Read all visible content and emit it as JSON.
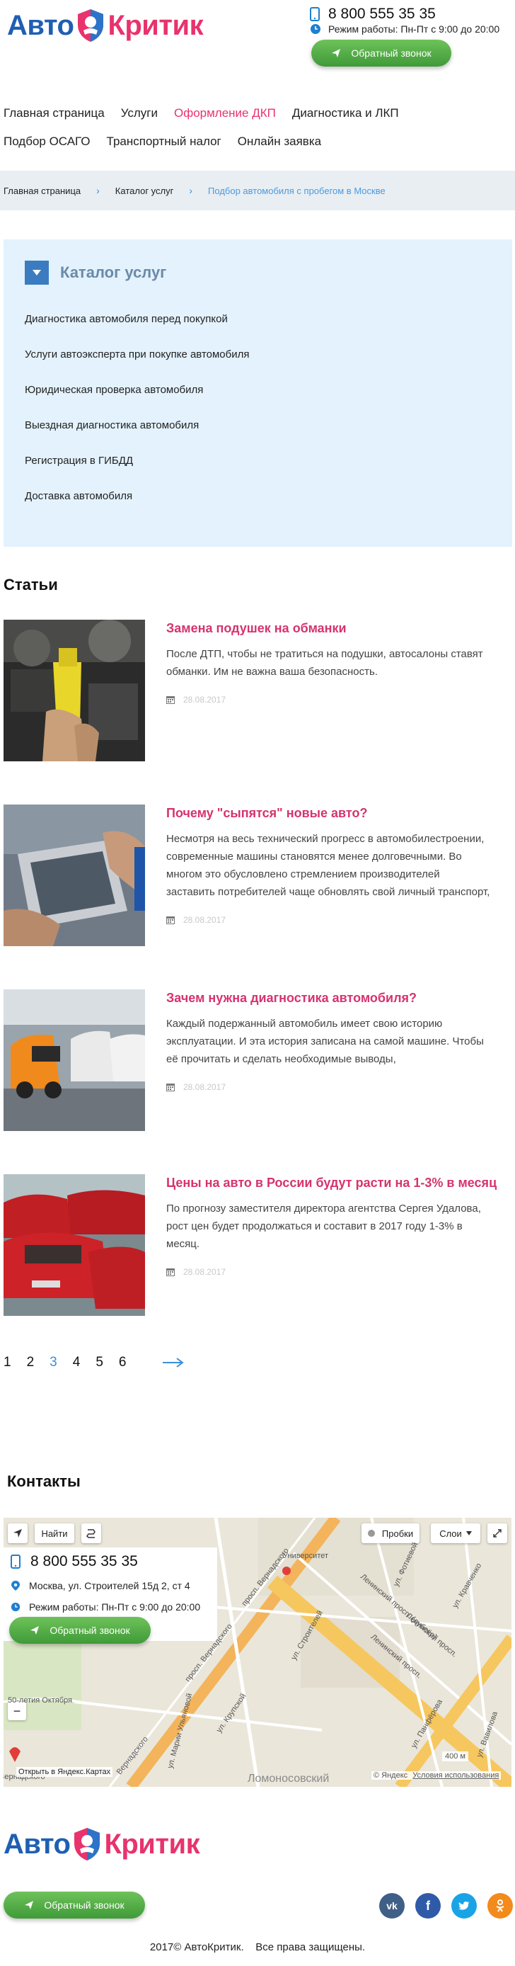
{
  "logo": {
    "part1": "Авто",
    "part2": "Критик"
  },
  "header": {
    "phone": "8 800 555 35 35",
    "hours": "Режим работы: Пн-Пт с 9:00 до 20:00",
    "callback": "Обратный звонок"
  },
  "nav": {
    "row1": [
      "Главная страница",
      "Услуги",
      "Оформление ДКП",
      "Диагностика и ЛКП"
    ],
    "row2": [
      "Подбор ОСАГО",
      "Транспортный налог",
      "Онлайн заявка"
    ],
    "active": "Оформление ДКП"
  },
  "breadcrumb": [
    "Главная страница",
    "Каталог услуг",
    "Подбор автомобиля с пробегом в Москве"
  ],
  "catalog": {
    "title": "Каталог услуг",
    "items": [
      "Диагностика автомобиля перед покупкой",
      "Услуги автоэксперта при покупке автомобиля",
      "Юридическая проверка автомобиля",
      "Выездная диагностика автомобиля",
      "Регистрация в ГИБДД",
      "Доставка автомобиля"
    ]
  },
  "articles_title": "Статьи",
  "articles": [
    {
      "title": "Замена подушек на обманки",
      "text": [
        "После ДТП, чтобы не тратиться на подушки, автосалоны ставят",
        "обманки. Им не важна ваша безопасность."
      ],
      "date": "28.08.2017",
      "image": "airbag-connector-photo"
    },
    {
      "title": "Почему \"сыпятся\" новые авто?",
      "text": [
        "Несмотря на весь технический прогресс в автомобилестроении,",
        "современные машины становятся менее долговечными. Во",
        "многом это обусловлено стремлением производителей",
        "заставить потребителей чаще обновлять свой личный транспорт,"
      ],
      "date": "28.08.2017",
      "image": "diagnostic-tablet-photo"
    },
    {
      "title": "Зачем нужна диагностика автомобиля?",
      "text": [
        "Каждый подержанный автомобиль имеет свою историю",
        "эксплуатации. И эта история записана на самой машине. Чтобы",
        "её прочитать и сделать необходимые выводы,"
      ],
      "date": "28.08.2017",
      "image": "parked-cars-photo"
    },
    {
      "title": "Цены на авто в России будут расти на 1-3% в месяц",
      "text": [
        "По прогнозу заместителя директора агентства Сергея Удалова,",
        "рост цен будет продолжаться и составит в 2017 году 1-3% в",
        "месяц."
      ],
      "date": "28.08.2017",
      "image": "red-cars-photo"
    }
  ],
  "pagination": {
    "pages": [
      "1",
      "2",
      "3",
      "4",
      "5",
      "6"
    ],
    "current": "3"
  },
  "contacts": {
    "title": "Контакты",
    "phone": "8 800 555 35 35",
    "address": "Москва, ул. Строителей 15д 2, ст 4",
    "hours": "Режим работы: Пн-Пт с 9:00 до 20:00",
    "callback": "Обратный звонок"
  },
  "map": {
    "find": "Найти",
    "traffic": "Пробки",
    "layers": "Слои",
    "open_in": "Открыть в Яндекс.Картах",
    "scale": "400 м",
    "attribution_brand": "© Яндекс",
    "terms": "Условия использования",
    "labels": {
      "university": "Университет",
      "vernadsky1": "просп. Вернадского",
      "vernadsky2": "просп. Вернадского",
      "vernadsky3": "Вернадского",
      "lomonosov": "Ломоносовский",
      "fotievoy": "ул. Фотиевой",
      "stroiteley": "ул. Строителей",
      "kravchenko": "ул. Кравченко",
      "krupskoy": "ул. Крупской",
      "ulyanovoy": "ул. Марии Ульяновой",
      "pankratova": "ул. Панфёрова",
      "vavilova": "ул. Вавилова",
      "leninsky1": "Ленинский просп.",
      "leninsky2": "Ленинский просп.",
      "leninsky_dubler": "Ленинский просп. (дублёр)",
      "fifty_years": "50-летия Октября",
      "vernadskogo_left": "Вернадского"
    }
  },
  "footer": {
    "callback": "Обратный звонок",
    "socials": [
      "vk",
      "facebook",
      "twitter",
      "odnoklassniki"
    ],
    "copyright": "2017© АвтоКритик.    Все права защищены."
  },
  "colors": {
    "brand_blue": "#1f5fb3",
    "brand_pink": "#e8336d",
    "accent_green": "#4caf45",
    "link_blue": "#3d8fd6"
  }
}
